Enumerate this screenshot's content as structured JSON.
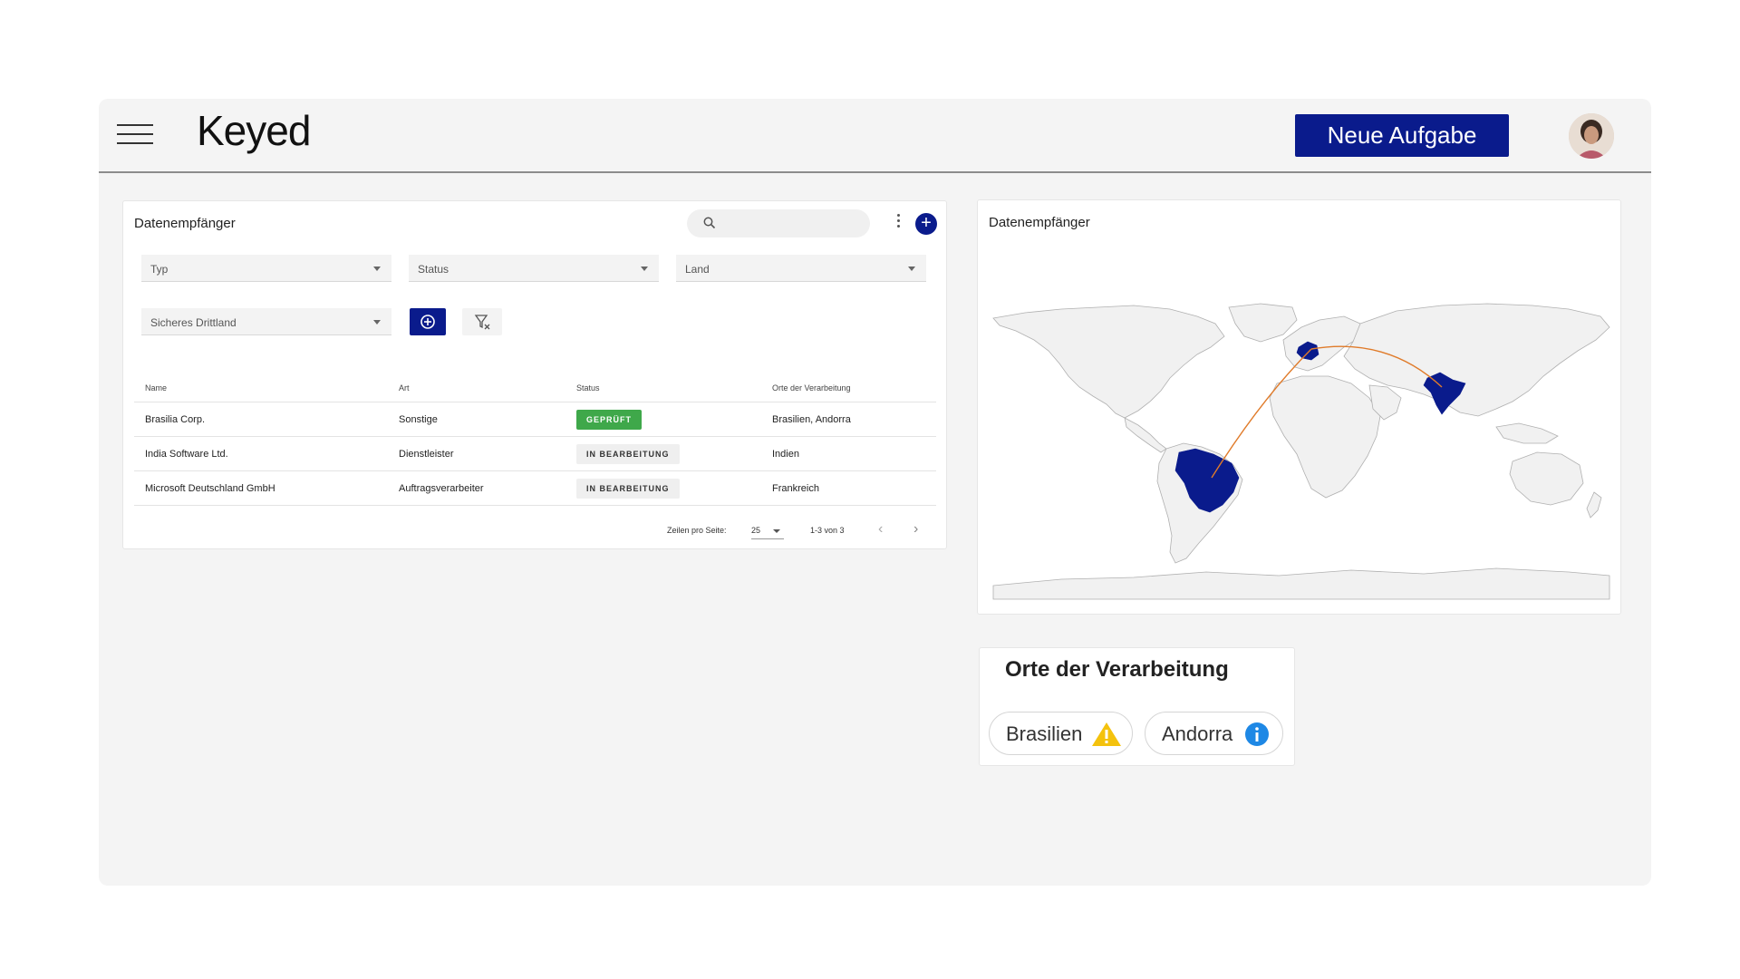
{
  "header": {
    "logo": "Keyed",
    "new_task_label": "Neue Aufgabe",
    "avatar_icon": "user-avatar"
  },
  "recipients": {
    "title": "Datenempfänger",
    "search": {
      "value": "",
      "placeholder": ""
    },
    "filters": {
      "typ": "Typ",
      "status": "Status",
      "land": "Land",
      "sicheres_drittland": "Sicheres Drittland"
    },
    "columns": [
      "Name",
      "Art",
      "Status",
      "Orte der Verarbeitung"
    ],
    "rows": [
      {
        "name": "Brasilia Corp.",
        "art": "Sonstige",
        "status": "GEPRÜFT",
        "orte": "Brasilien, Andorra"
      },
      {
        "name": "India Software Ltd.",
        "art": "Dienstleister",
        "status": "IN BEARBEITUNG",
        "orte": "Indien"
      },
      {
        "name": "Microsoft Deutschland GmbH",
        "art": "Auftragsverarbeiter",
        "status": "IN BEARBEITUNG",
        "orte": "Frankreich"
      }
    ],
    "pagination": {
      "rows_per_page_label": "Zeilen pro Seite:",
      "rows_per_page": "25",
      "range": "1-3 von 3"
    }
  },
  "map_card": {
    "title": "Datenempfänger",
    "highlighted_countries": [
      "France",
      "Brazil",
      "India"
    ],
    "highlight_color": "#0a1b8c",
    "route_color": "#e07b2a"
  },
  "orte": {
    "title": "Orte der Verarbeitung",
    "chips": [
      {
        "label": "Brasilien",
        "icon": "warning-icon",
        "color": "#f4c20d"
      },
      {
        "label": "Andorra",
        "icon": "info-icon",
        "color": "#1e88e5"
      }
    ]
  },
  "colors": {
    "brand": "#0a1b8c",
    "success": "#3fa84a"
  }
}
